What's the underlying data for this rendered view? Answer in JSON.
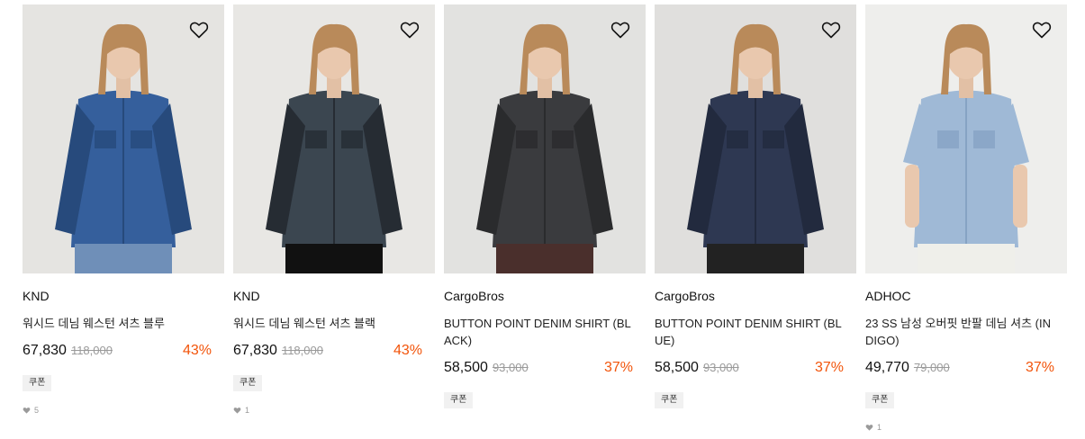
{
  "products": [
    {
      "brand": "KND",
      "name": "워시드 데님 웨스턴 셔츠 블루",
      "price": "67,830",
      "original_price": "118,000",
      "discount": "43%",
      "coupon": "쿠폰",
      "likes": "5",
      "shirt_color": "#355f9c",
      "shirt_shade": "#274a7c",
      "bottom_color": "#6f8fb8",
      "bg_color": "#e5e4e1"
    },
    {
      "brand": "KND",
      "name": "워시드 데님 웨스턴 셔츠 블랙",
      "price": "67,830",
      "original_price": "118,000",
      "discount": "43%",
      "coupon": "쿠폰",
      "likes": "1",
      "shirt_color": "#3b4650",
      "shirt_shade": "#262c33",
      "bottom_color": "#111111",
      "bg_color": "#e8e7e4"
    },
    {
      "brand": "CargoBros",
      "name": "BUTTON POINT DENIM SHIRT (BLACK)",
      "price": "58,500",
      "original_price": "93,000",
      "discount": "37%",
      "coupon": "쿠폰",
      "likes": "",
      "shirt_color": "#3a3b3e",
      "shirt_shade": "#2a2b2d",
      "bottom_color": "#4a2f2c",
      "bg_color": "#e2e2e0"
    },
    {
      "brand": "CargoBros",
      "name": "BUTTON POINT DENIM SHIRT (BLUE)",
      "price": "58,500",
      "original_price": "93,000",
      "discount": "37%",
      "coupon": "쿠폰",
      "likes": "",
      "shirt_color": "#2e3852",
      "shirt_shade": "#222a3e",
      "bottom_color": "#222222",
      "bg_color": "#e0dfdd"
    },
    {
      "brand": "ADHOC",
      "name": "23 SS 남성 오버핏 반팔 데님 셔츠 (INDIGO)",
      "price": "49,770",
      "original_price": "79,000",
      "discount": "37%",
      "coupon": "쿠폰",
      "likes": "1",
      "shirt_color": "#9fb9d6",
      "shirt_shade": "#86a3c4",
      "bottom_color": "#efefea",
      "bg_color": "#eeeeec"
    }
  ],
  "icons": {
    "like": "heart-outline-icon",
    "like_count": "heart-filled-icon"
  },
  "colors": {
    "discount": "#f2540a",
    "original_price": "#9a9a9a",
    "coupon_bg": "#f1f1f1"
  }
}
